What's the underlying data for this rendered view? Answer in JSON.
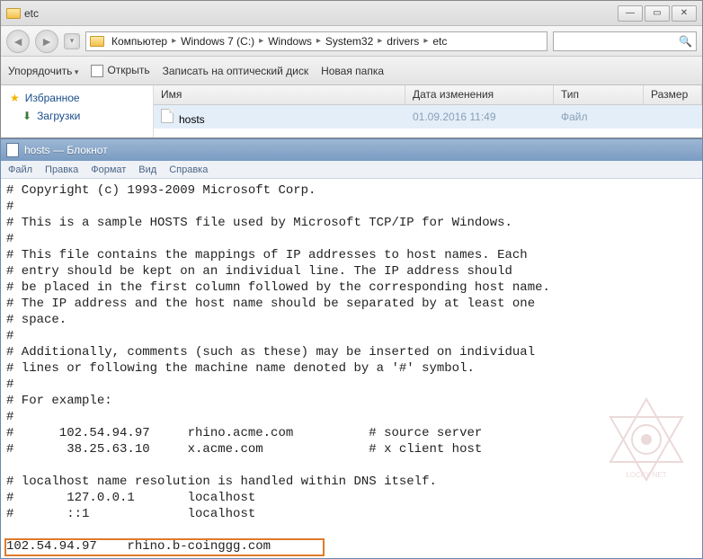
{
  "explorer": {
    "title": "etc",
    "breadcrumb": [
      "Компьютер",
      "Windows 7 (C:)",
      "Windows",
      "System32",
      "drivers",
      "etc"
    ],
    "toolbar": {
      "organize": "Упорядочить",
      "open": "Открыть",
      "burn": "Записать на оптический диск",
      "newfolder": "Новая папка"
    },
    "sidebar": {
      "favorites": "Избранное",
      "downloads": "Загрузки"
    },
    "columns": {
      "name": "Имя",
      "date": "Дата изменения",
      "type": "Тип",
      "size": "Размер"
    },
    "row": {
      "name": "hosts",
      "date": "01.09.2016 11:49",
      "type": "Файл"
    }
  },
  "notepad": {
    "title": "hosts — Блокнот",
    "menu": {
      "file": "Файл",
      "edit": "Правка",
      "format": "Формат",
      "view": "Вид",
      "help": "Справка"
    },
    "content": "# Copyright (c) 1993-2009 Microsoft Corp.\n#\n# This is a sample HOSTS file used by Microsoft TCP/IP for Windows.\n#\n# This file contains the mappings of IP addresses to host names. Each\n# entry should be kept on an individual line. The IP address should\n# be placed in the first column followed by the corresponding host name.\n# The IP address and the host name should be separated by at least one\n# space.\n#\n# Additionally, comments (such as these) may be inserted on individual\n# lines or following the machine name denoted by a '#' symbol.\n#\n# For example:\n#\n#      102.54.94.97     rhino.acme.com          # source server\n#       38.25.63.10     x.acme.com              # x client host\n\n# localhost name resolution is handled within DNS itself.\n#       127.0.0.1       localhost\n#       ::1             localhost\n\n102.54.94.97    rhino.b-coinggg.com"
  }
}
